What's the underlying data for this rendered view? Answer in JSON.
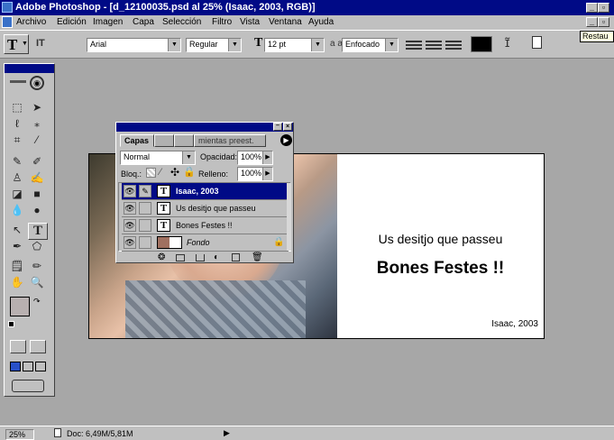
{
  "titlebar": {
    "title": "Adobe Photoshop - [d_12100035.psd al 25% (Isaac, 2003, RGB)]",
    "restore_tooltip": "Restau"
  },
  "menu": [
    "Archivo",
    "Edición",
    "Imagen",
    "Capa",
    "Selección",
    "Filtro",
    "Vista",
    "Ventana",
    "Ayuda"
  ],
  "options": {
    "tool_letter": "T",
    "orientation_icon": "IT",
    "font_family": "Arial",
    "font_style": "Regular",
    "font_size": "12 pt",
    "aa_label": "a a",
    "antialias": "Enfocado",
    "color": "#000000"
  },
  "palette": {
    "tabs": [
      "Capas",
      "",
      "",
      "mientas preest."
    ],
    "blend_mode": "Normal",
    "opacity_label": "Opacidad:",
    "opacity": "100%",
    "lock_label": "Bloq.:",
    "fill_label": "Relleno:",
    "fill": "100%",
    "layers": [
      {
        "name": "Isaac, 2003",
        "type": "text",
        "selected": true
      },
      {
        "name": "Us desitjo que passeu",
        "type": "text",
        "selected": false
      },
      {
        "name": "Bones Festes !!",
        "type": "text",
        "selected": false
      },
      {
        "name": "Fondo",
        "type": "image",
        "selected": false
      }
    ]
  },
  "canvas": {
    "line1": "Us desitjo que passeu",
    "line2": "Bones Festes !!",
    "line3": "Isaac, 2003"
  },
  "status": {
    "zoom": "25%",
    "doc": "Doc: 6,49M/5,81M"
  }
}
